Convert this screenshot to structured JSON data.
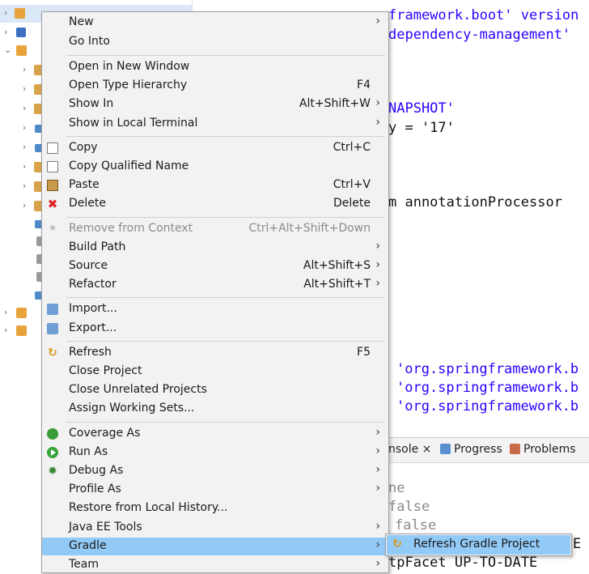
{
  "editor": {
    "lines": [
      {
        "text": "framework.boot' version",
        "cls": "str"
      },
      {
        "text": "dependency-management'",
        "cls": "str"
      },
      {
        "text": "NAPSHOT'",
        "cls": "str"
      },
      {
        "text": "y = '17'",
        "cls": "plain"
      },
      {
        "text": "m annotationProcessor",
        "cls": "plain"
      },
      {
        "text": "'org.springframework.b",
        "cls": "str"
      },
      {
        "text": "'org.springframework.b",
        "cls": "str"
      },
      {
        "text": "'org.springframework.b",
        "cls": "str"
      }
    ]
  },
  "console": {
    "tabs": [
      "nsole ×",
      "Progress",
      "Problems"
    ],
    "lines": [
      "ne",
      "false",
      "false",
      "E",
      "tpFacet UP-TO-DATE"
    ]
  },
  "menu": {
    "items": [
      {
        "label": "New",
        "arrow": true
      },
      {
        "label": "Go Into"
      },
      {
        "sep": true
      },
      {
        "label": "Open in New Window"
      },
      {
        "label": "Open Type Hierarchy",
        "accel": "F4"
      },
      {
        "label": "Show In",
        "accel": "Alt+Shift+W",
        "arrow": true
      },
      {
        "label": "Show in Local Terminal",
        "arrow": true
      },
      {
        "sep": true
      },
      {
        "label": "Copy",
        "accel": "Ctrl+C",
        "icon": "copy-icon"
      },
      {
        "label": "Copy Qualified Name",
        "icon": "copy-qualified-icon"
      },
      {
        "label": "Paste",
        "accel": "Ctrl+V",
        "icon": "paste-icon"
      },
      {
        "label": "Delete",
        "accel": "Delete",
        "icon": "delete-icon"
      },
      {
        "sep": true
      },
      {
        "label": "Remove from Context",
        "accel": "Ctrl+Alt+Shift+Down",
        "icon": "remove-context-icon",
        "disabled": true
      },
      {
        "label": "Build Path",
        "arrow": true
      },
      {
        "label": "Source",
        "accel": "Alt+Shift+S",
        "arrow": true
      },
      {
        "label": "Refactor",
        "accel": "Alt+Shift+T",
        "arrow": true
      },
      {
        "sep": true
      },
      {
        "label": "Import...",
        "icon": "import-icon"
      },
      {
        "label": "Export...",
        "icon": "export-icon"
      },
      {
        "sep": true
      },
      {
        "label": "Refresh",
        "accel": "F5",
        "icon": "refresh-icon"
      },
      {
        "label": "Close Project"
      },
      {
        "label": "Close Unrelated Projects"
      },
      {
        "label": "Assign Working Sets..."
      },
      {
        "sep": true
      },
      {
        "label": "Coverage As",
        "arrow": true,
        "icon": "coverage-icon"
      },
      {
        "label": "Run As",
        "arrow": true,
        "icon": "run-icon"
      },
      {
        "label": "Debug As",
        "arrow": true,
        "icon": "debug-icon"
      },
      {
        "label": "Profile As",
        "arrow": true
      },
      {
        "label": "Restore from Local History..."
      },
      {
        "label": "Java EE Tools",
        "arrow": true
      },
      {
        "label": "Gradle",
        "arrow": true,
        "highlighted": true
      },
      {
        "label": "Team",
        "arrow": true
      }
    ]
  },
  "submenu": {
    "label": "Refresh Gradle Project",
    "icon": "refresh-gradle-icon"
  },
  "colors": {
    "highlight": "#91c9f7",
    "menu_bg": "#f2f2f2",
    "keyword": "#7f0055",
    "string": "#2a00ff"
  }
}
